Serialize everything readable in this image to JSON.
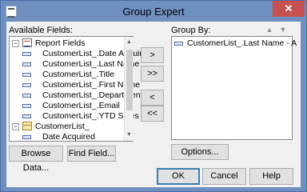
{
  "window": {
    "title": "Group Expert",
    "close_glyph": "✕"
  },
  "available_fields": {
    "label": "Available Fields:",
    "report_fields_label": "Report Fields",
    "report_fields": [
      "CustomerList_.Date Acquired",
      "CustomerList_.Last Name",
      "CustomerList_.Title",
      "CustomerList_.First Name",
      "CustomerList_.Department",
      "CustomerList_.Email",
      "CustomerList_.YTD Sales"
    ],
    "table_label": "CustomerList_",
    "table_fields": [
      "Date Acquired"
    ]
  },
  "group_by": {
    "label": "Group By:",
    "items": [
      "CustomerList_.Last Name - A"
    ],
    "move_up_glyph": "▲",
    "move_down_glyph": "▼"
  },
  "transfer_buttons": {
    "add": ">",
    "add_all": ">>",
    "remove": "<",
    "remove_all": "<<"
  },
  "buttons": {
    "browse_data": "Browse Data...",
    "find_field": "Find Field...",
    "options": "Options...",
    "ok": "OK",
    "cancel": "Cancel",
    "help": "Help"
  },
  "icons": {
    "expanded": "−",
    "scroll_up": "▲",
    "scroll_down": "▼"
  }
}
